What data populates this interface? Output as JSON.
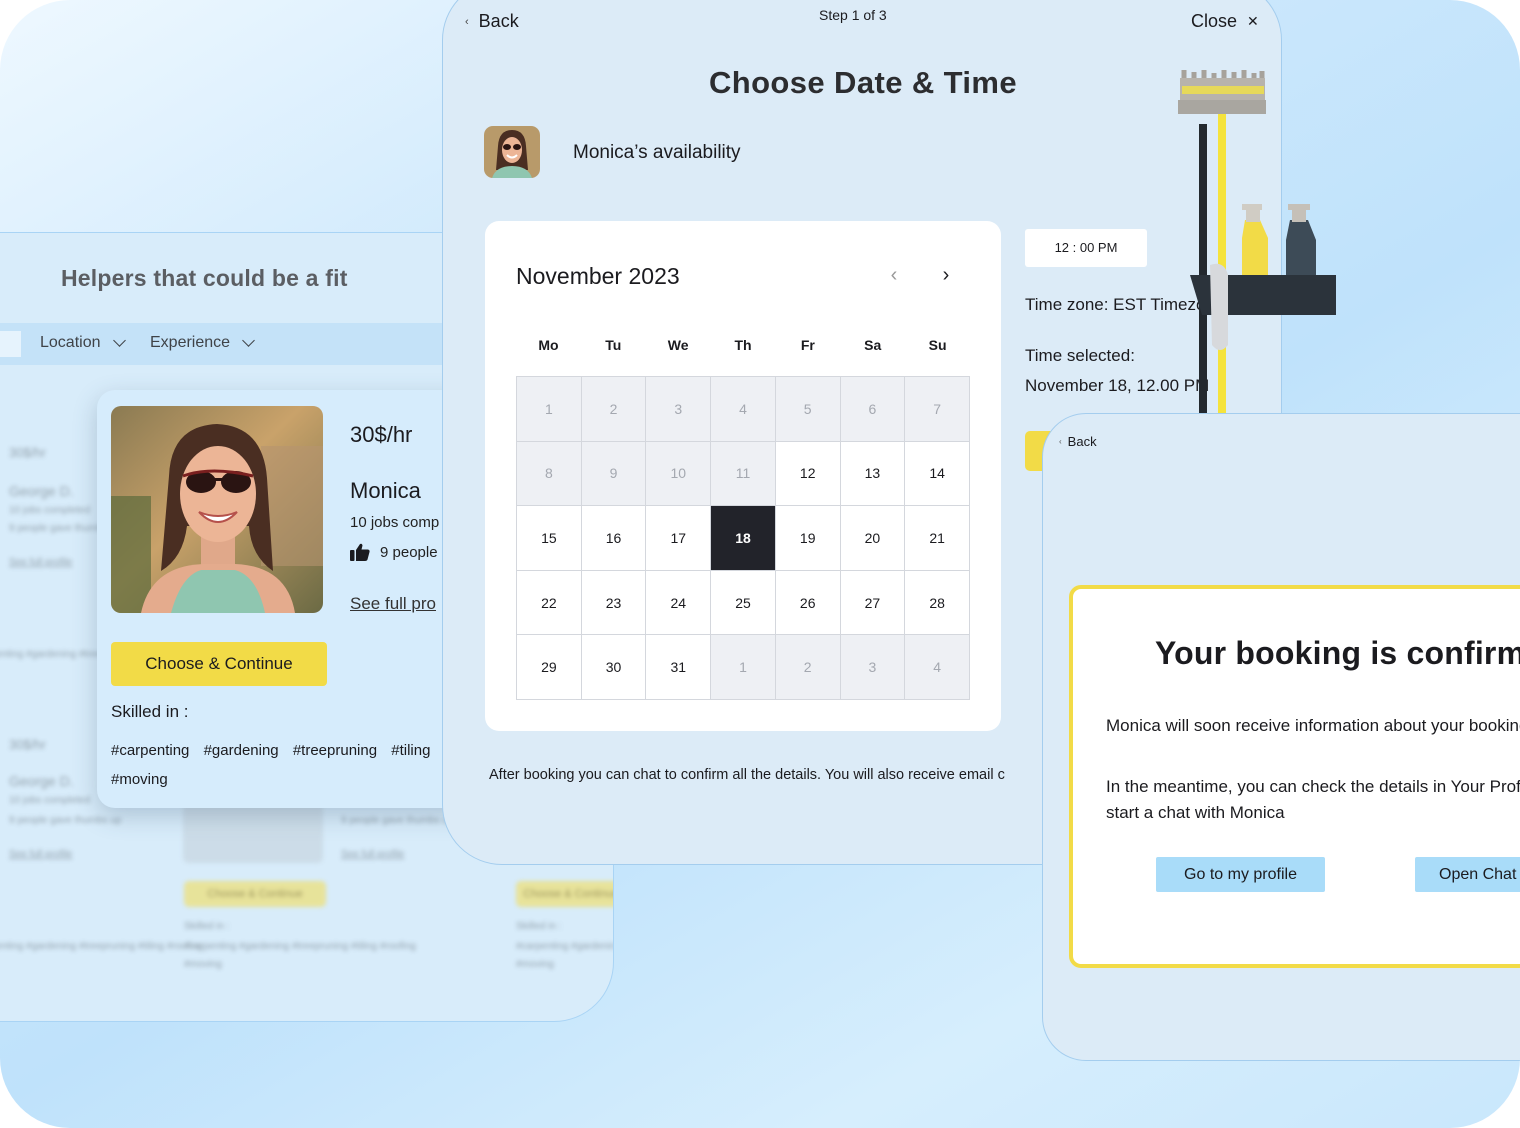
{
  "helpers": {
    "title": "Helpers that could be a fit",
    "filters": [
      "Location",
      "Experience"
    ],
    "background_cards": {
      "rate": "30$/hr",
      "name": "George D.",
      "jobs": "10 jobs completed",
      "likes": "9 people gave thumbs up",
      "link": "See full profile",
      "button": "Choose & Continue",
      "skilled": "Skilled in :",
      "tags": "#carpenting #gardening #treepruning #tiling #roofing",
      "tags_extra": "#moving"
    },
    "card": {
      "rate": "30$/hr",
      "name": "Monica",
      "jobs": "10 jobs comp",
      "likes": "9 people",
      "link": "See full pro",
      "button": "Choose & Continue",
      "skilled_label": "Skilled in :",
      "tags": [
        "#carpenting",
        "#gardening",
        "#treepruning",
        "#tiling",
        "#moving"
      ]
    }
  },
  "booking": {
    "back": "Back",
    "step": "Step 1 of 3",
    "close": "Close",
    "title": "Choose Date & Time",
    "availability": "Monica’s availability",
    "calendar": {
      "month": "November 2023",
      "weekdays": [
        "Mo",
        "Tu",
        "We",
        "Th",
        "Fr",
        "Sa",
        "Su"
      ],
      "days": [
        {
          "d": "1",
          "m": true
        },
        {
          "d": "2",
          "m": true
        },
        {
          "d": "3",
          "m": true
        },
        {
          "d": "4",
          "m": true
        },
        {
          "d": "5",
          "m": true
        },
        {
          "d": "6",
          "m": true
        },
        {
          "d": "7",
          "m": true
        },
        {
          "d": "8",
          "m": true
        },
        {
          "d": "9",
          "m": true
        },
        {
          "d": "10",
          "m": true
        },
        {
          "d": "11",
          "m": true
        },
        {
          "d": "12"
        },
        {
          "d": "13"
        },
        {
          "d": "14"
        },
        {
          "d": "15"
        },
        {
          "d": "16"
        },
        {
          "d": "17"
        },
        {
          "d": "18",
          "sel": true
        },
        {
          "d": "19"
        },
        {
          "d": "20"
        },
        {
          "d": "21"
        },
        {
          "d": "22"
        },
        {
          "d": "23"
        },
        {
          "d": "24"
        },
        {
          "d": "25"
        },
        {
          "d": "26"
        },
        {
          "d": "27"
        },
        {
          "d": "28"
        },
        {
          "d": "29"
        },
        {
          "d": "30"
        },
        {
          "d": "31"
        },
        {
          "d": "1",
          "m": true
        },
        {
          "d": "2",
          "m": true
        },
        {
          "d": "3",
          "m": true
        },
        {
          "d": "4",
          "m": true
        }
      ]
    },
    "time": "12 : 00 PM",
    "timezone": "Time zone: EST Timezo",
    "time_selected_label": "Time selected:",
    "time_selected_value": "November 18, 12.00 PM",
    "note": "After booking you can chat to confirm all the details. You will also receive email c"
  },
  "confirmation": {
    "back": "Back",
    "title": "Your booking is confirmed",
    "p1": "Monica will soon receive information about your booking",
    "p2_line1": "In the meantime, you can check the details in Your Profile or",
    "p2_line2": "start a chat with Monica",
    "profile_button": "Go to my profile",
    "chat_button": "Open Chat"
  },
  "colors": {
    "accent_yellow": "#f2db47",
    "panel_blue": "#dcebf7",
    "button_blue": "#a9dcf9",
    "selected_day": "#22232a"
  }
}
